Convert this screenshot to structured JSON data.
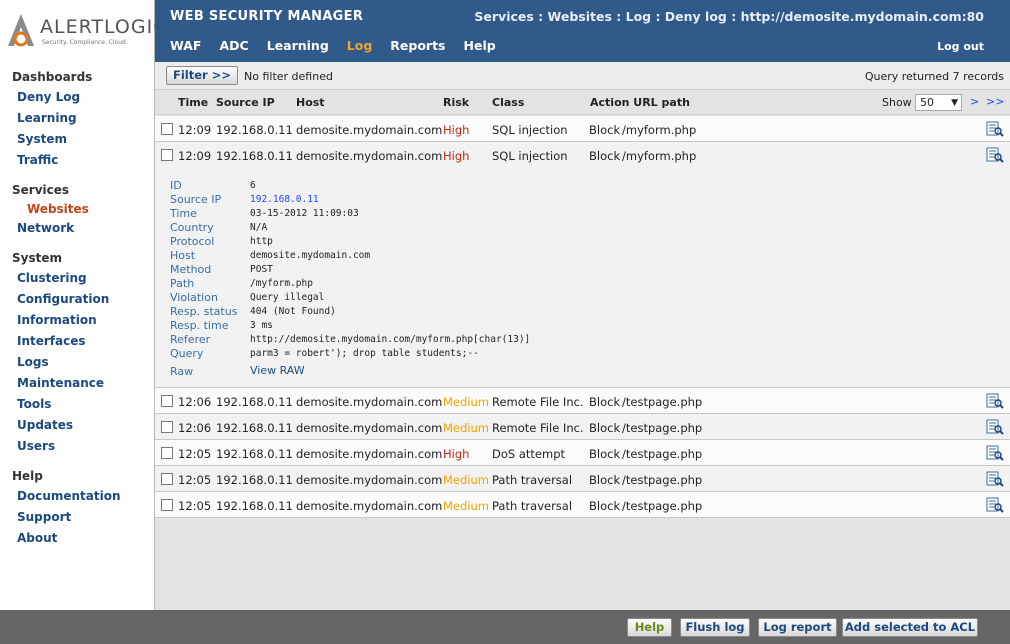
{
  "brand": {
    "name": "ALERTLOGIC",
    "tagline": "Security. Compliance. Cloud."
  },
  "header": {
    "title": "WEB SECURITY MANAGER",
    "breadcrumb": "Services : Websites : Log : Deny log :  http://demosite.mydomain.com:80",
    "nav": [
      "WAF",
      "ADC",
      "Learning",
      "Log",
      "Reports",
      "Help"
    ],
    "active_nav": "Log",
    "logout": "Log out"
  },
  "sidebar": {
    "groups": [
      {
        "title": "Dashboards",
        "items": [
          {
            "label": "Deny Log"
          },
          {
            "label": "Learning"
          },
          {
            "label": "System"
          },
          {
            "label": "Traffic"
          }
        ]
      },
      {
        "title": "Services",
        "items": [
          {
            "label": "Websites",
            "active": true
          },
          {
            "label": "Network"
          }
        ]
      },
      {
        "title": "System",
        "items": [
          {
            "label": "Clustering"
          },
          {
            "label": "Configuration"
          },
          {
            "label": "Information"
          },
          {
            "label": "Interfaces"
          },
          {
            "label": "Logs"
          },
          {
            "label": "Maintenance"
          },
          {
            "label": "Tools"
          },
          {
            "label": "Updates"
          },
          {
            "label": "Users"
          }
        ]
      },
      {
        "title": "Help",
        "items": [
          {
            "label": "Documentation"
          },
          {
            "label": "Support"
          },
          {
            "label": "About"
          }
        ]
      }
    ]
  },
  "filter": {
    "button": "Filter >>",
    "status": "No filter defined",
    "query_result": "Query returned 7 records"
  },
  "table": {
    "columns": {
      "time": "Time",
      "source_ip": "Source IP",
      "host": "Host",
      "risk": "Risk",
      "class": "Class",
      "action_url": "Action URL path"
    },
    "show_label": "Show",
    "show_value": "50",
    "pager_next": ">",
    "pager_last": ">>",
    "rows": [
      {
        "time": "12:09",
        "ip": "192.168.0.11",
        "host": "demosite.mydomain.com",
        "risk": "High",
        "class": "SQL injection",
        "action": "Block",
        "path": "/myform.php"
      },
      {
        "time": "12:09",
        "ip": "192.168.0.11",
        "host": "demosite.mydomain.com",
        "risk": "High",
        "class": "SQL injection",
        "action": "Block",
        "path": "/myform.php"
      },
      {
        "time": "12:06",
        "ip": "192.168.0.11",
        "host": "demosite.mydomain.com",
        "risk": "Medium",
        "class": "Remote File Inc.",
        "action": "Block",
        "path": "/testpage.php"
      },
      {
        "time": "12:06",
        "ip": "192.168.0.11",
        "host": "demosite.mydomain.com",
        "risk": "Medium",
        "class": "Remote File Inc.",
        "action": "Block",
        "path": "/testpage.php"
      },
      {
        "time": "12:05",
        "ip": "192.168.0.11",
        "host": "demosite.mydomain.com",
        "risk": "High",
        "class": "DoS attempt",
        "action": "Block",
        "path": "/testpage.php"
      },
      {
        "time": "12:05",
        "ip": "192.168.0.11",
        "host": "demosite.mydomain.com",
        "risk": "Medium",
        "class": "Path traversal",
        "action": "Block",
        "path": "/testpage.php"
      },
      {
        "time": "12:05",
        "ip": "192.168.0.11",
        "host": "demosite.mydomain.com",
        "risk": "Medium",
        "class": "Path traversal",
        "action": "Block",
        "path": "/testpage.php"
      }
    ]
  },
  "detail": {
    "fields": [
      {
        "label": "ID",
        "value": "6"
      },
      {
        "label": "Source IP",
        "value": "192.168.0.11",
        "link": true
      },
      {
        "label": "Time",
        "value": "03-15-2012 11:09:03"
      },
      {
        "label": "Country",
        "value": "N/A"
      },
      {
        "label": "Protocol",
        "value": "http"
      },
      {
        "label": "Host",
        "value": "demosite.mydomain.com"
      },
      {
        "label": "Method",
        "value": "POST"
      },
      {
        "label": "Path",
        "value": "/myform.php"
      },
      {
        "label": "Violation",
        "value": "Query illegal"
      },
      {
        "label": "Resp. status",
        "value": "404 (Not Found)"
      },
      {
        "label": "Resp. time",
        "value": "3 ms"
      },
      {
        "label": "Referer",
        "value": "http://demosite.mydomain.com/myform.php[char(13)]"
      },
      {
        "label": "Query",
        "value": "parm3 = robert'); drop table students;--"
      }
    ],
    "raw_label": "Raw",
    "raw_link": "View RAW"
  },
  "footer": {
    "help": "Help",
    "flush": "Flush log",
    "report": "Log report",
    "acl": "Add selected to ACL"
  },
  "colors": {
    "header": "#305a8a",
    "active": "#f2a230",
    "high": "#c0281a",
    "medium": "#f0a500",
    "link": "#1d4a7e"
  }
}
